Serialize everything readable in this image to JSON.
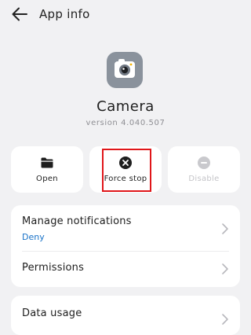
{
  "header": {
    "title": "App info",
    "back_icon": "arrow-left-icon"
  },
  "app": {
    "name": "Camera",
    "version": "version 4.040.507",
    "icon": "camera-icon",
    "icon_color": "#8a929c"
  },
  "actions": [
    {
      "label": "Open",
      "icon": "folder-icon",
      "enabled": true
    },
    {
      "label": "Force stop",
      "icon": "close-circle-icon",
      "enabled": true,
      "highlighted": true
    },
    {
      "label": "Disable",
      "icon": "minus-circle-icon",
      "enabled": false
    }
  ],
  "settings": {
    "notifications": {
      "title": "Manage notifications",
      "value": "Deny"
    },
    "permissions": {
      "title": "Permissions"
    },
    "data_usage": {
      "title": "Data usage"
    }
  },
  "colors": {
    "background": "#f1f1f3",
    "card": "#ffffff",
    "accent_link": "#1a73c8",
    "highlight_border": "#e0161a",
    "disabled_text": "#c4c4c8"
  }
}
